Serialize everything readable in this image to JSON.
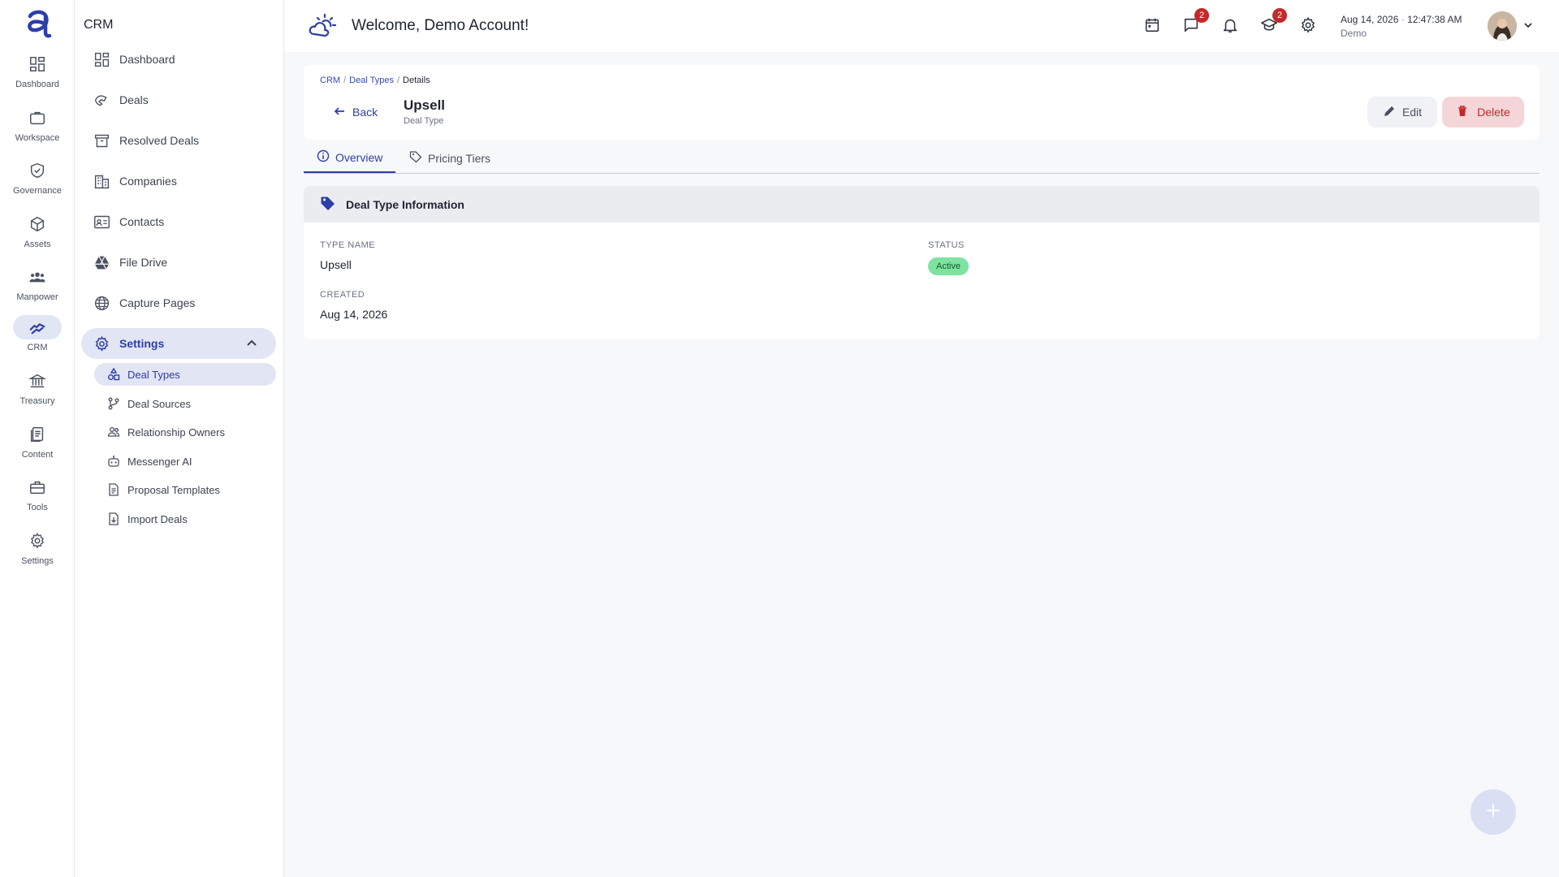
{
  "rail": {
    "items": [
      {
        "label": "Dashboard",
        "icon": "dashboard-icon"
      },
      {
        "label": "Workspace",
        "icon": "briefcase-icon"
      },
      {
        "label": "Governance",
        "icon": "shield-check-icon"
      },
      {
        "label": "Assets",
        "icon": "cube-icon"
      },
      {
        "label": "Manpower",
        "icon": "people-icon"
      },
      {
        "label": "CRM",
        "icon": "handshake-icon"
      },
      {
        "label": "Treasury",
        "icon": "bank-icon"
      },
      {
        "label": "Content",
        "icon": "document-icon"
      },
      {
        "label": "Tools",
        "icon": "toolbox-icon"
      },
      {
        "label": "Settings",
        "icon": "gear-icon"
      }
    ]
  },
  "sidebar": {
    "title": "CRM",
    "items": [
      {
        "label": "Dashboard"
      },
      {
        "label": "Deals"
      },
      {
        "label": "Resolved Deals"
      },
      {
        "label": "Companies"
      },
      {
        "label": "Contacts"
      },
      {
        "label": "File Drive"
      },
      {
        "label": "Capture Pages"
      },
      {
        "label": "Settings"
      }
    ],
    "subitems": [
      {
        "label": "Deal Types"
      },
      {
        "label": "Deal Sources"
      },
      {
        "label": "Relationship Owners"
      },
      {
        "label": "Messenger AI"
      },
      {
        "label": "Proposal Templates"
      },
      {
        "label": "Import Deals"
      }
    ]
  },
  "header": {
    "welcome": "Welcome, Demo Account!",
    "messages_badge": "2",
    "courses_badge": "2",
    "date": "Aug 14, 2026",
    "separator": "·",
    "time": "12:47:38 AM",
    "user": "Demo"
  },
  "breadcrumb": {
    "crm": "CRM",
    "deal_types": "Deal Types",
    "current": "Details",
    "sep": "/"
  },
  "page": {
    "back_label": "Back",
    "title": "Upsell",
    "subtitle": "Deal Type",
    "edit_label": "Edit",
    "delete_label": "Delete"
  },
  "tabs": [
    {
      "label": "Overview"
    },
    {
      "label": "Pricing Tiers"
    }
  ],
  "info": {
    "heading": "Deal Type Information",
    "type_name_label": "TYPE NAME",
    "type_name": "Upsell",
    "status_label": "STATUS",
    "status": "Active",
    "created_label": "CREATED",
    "created": "Aug 14, 2026"
  },
  "colors": {
    "accent": "#2c3ea8",
    "danger": "#c62828",
    "success_bg": "#7ee2a0"
  }
}
